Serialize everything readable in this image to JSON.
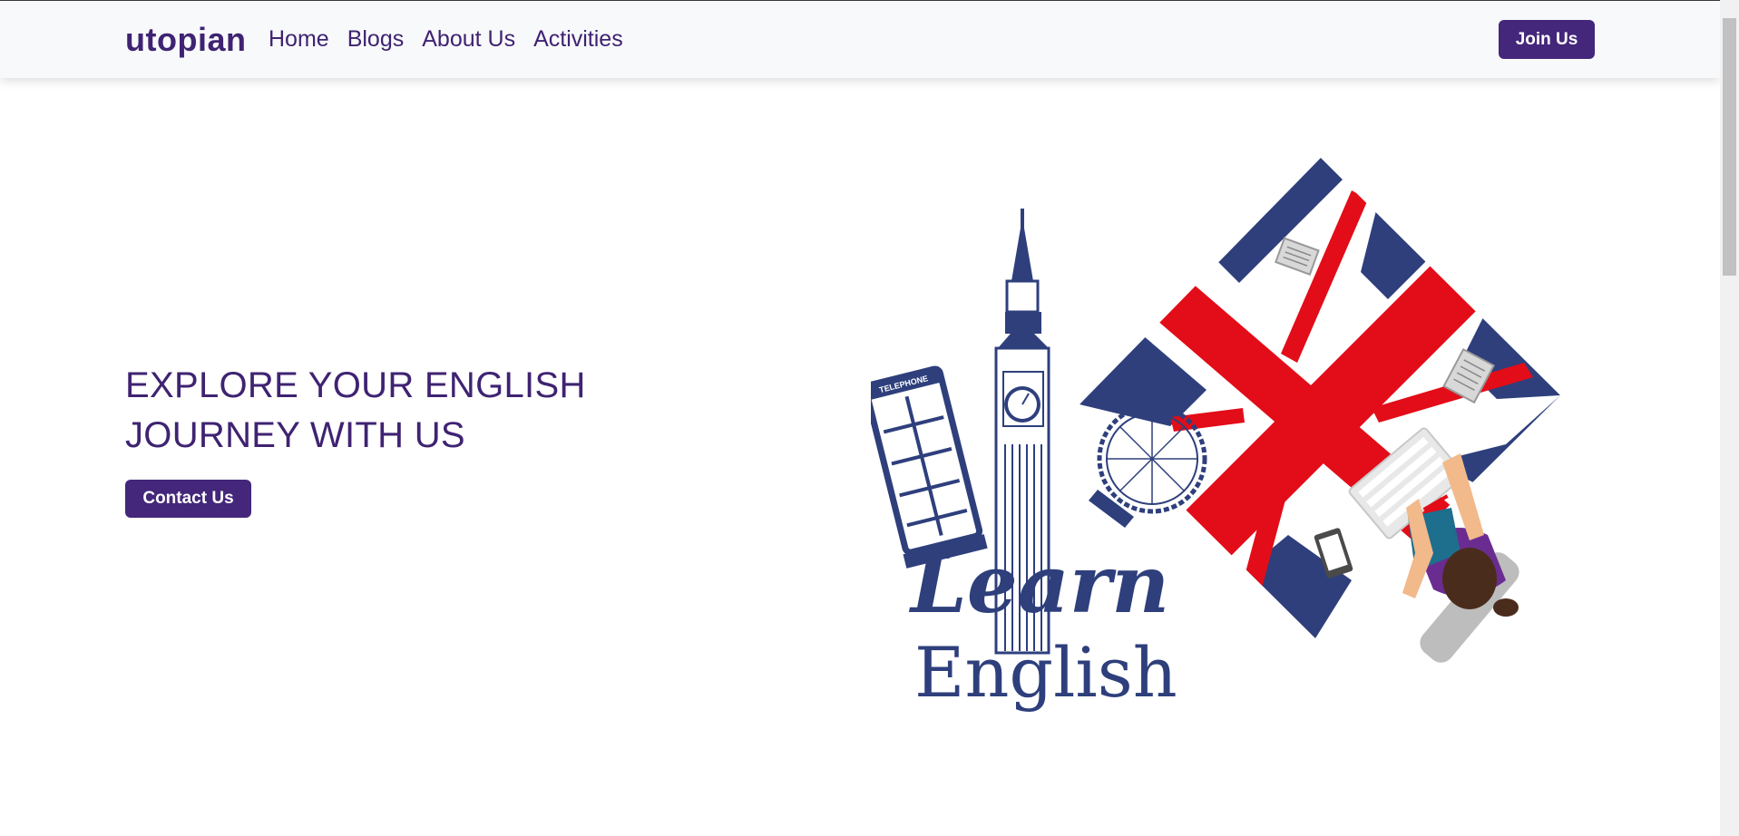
{
  "nav": {
    "brand": "utopian",
    "links": [
      {
        "label": "Home"
      },
      {
        "label": "Blogs"
      },
      {
        "label": "About Us"
      },
      {
        "label": "Activities"
      }
    ],
    "join_label": "Join Us"
  },
  "hero": {
    "title": "EXPLORE YOUR ENGLISH JOURNEY WITH US",
    "contact_label": "Contact Us",
    "illustration": {
      "telephone_label": "TELEPHONE",
      "learn_text": "Learn",
      "english_text": "English"
    }
  },
  "colors": {
    "brand_purple": "#3f2372",
    "button_purple": "#44277a",
    "flag_blue": "#2e3f7c",
    "flag_red": "#e20d18",
    "navbar_bg": "#f8f9fa"
  }
}
